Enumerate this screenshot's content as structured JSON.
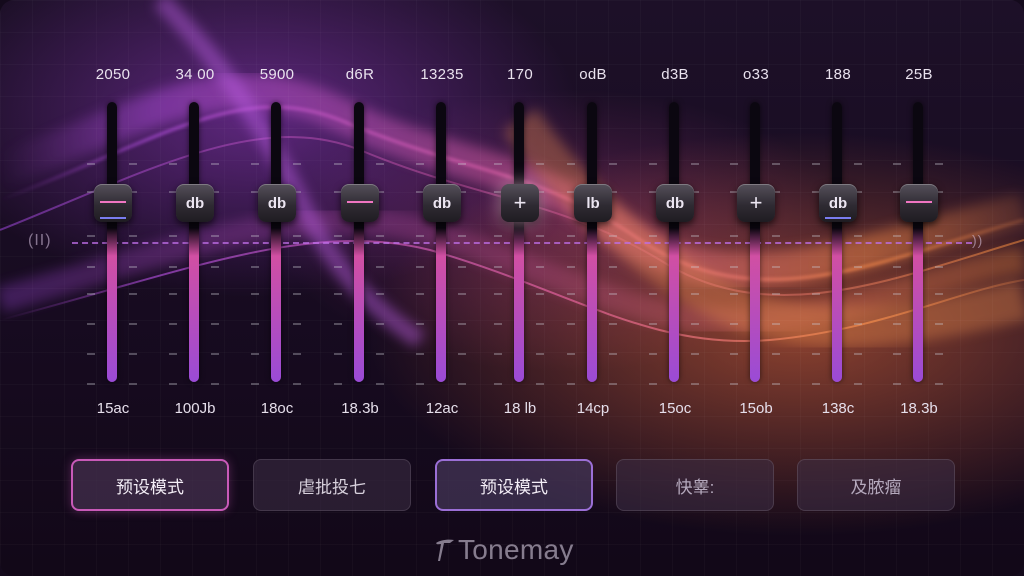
{
  "app": {
    "brand_name": "Tonemay",
    "accent_colors": {
      "pink": "#d14fa3",
      "violet": "#9a4bd6",
      "orange": "#f08a3c"
    }
  },
  "side_labels": {
    "left": "(II)",
    "right": "))"
  },
  "bands": [
    {
      "freq": "2050",
      "gain": "15ac",
      "knob_label": "",
      "knob_icon": "line-pink-blue"
    },
    {
      "freq": "34 00",
      "gain": "100Jb",
      "knob_label": "db",
      "knob_icon": ""
    },
    {
      "freq": "5900",
      "gain": "18oc",
      "knob_label": "db",
      "knob_icon": ""
    },
    {
      "freq": "d6R",
      "gain": "18.3b",
      "knob_label": "",
      "knob_icon": "line-pink"
    },
    {
      "freq": "13235",
      "gain": "12ac",
      "knob_label": "db",
      "knob_icon": ""
    },
    {
      "freq": "170",
      "gain": "18 lb",
      "knob_label": "",
      "knob_icon": "plus-glow"
    },
    {
      "freq": "odB",
      "gain": "14cp",
      "knob_label": "lb",
      "knob_icon": ""
    },
    {
      "freq": "d3B",
      "gain": "15oc",
      "knob_label": "db",
      "knob_icon": ""
    },
    {
      "freq": "o33",
      "gain": "15ob",
      "knob_label": "",
      "knob_icon": "plus"
    },
    {
      "freq": "188",
      "gain": "138c",
      "knob_label": "db",
      "knob_icon": "line-blue"
    },
    {
      "freq": "25B",
      "gain": "18.3b",
      "knob_label": "",
      "knob_icon": "line-pink"
    }
  ],
  "presets": [
    {
      "label": "预设模式",
      "state": "active-pink"
    },
    {
      "label": "虐批投七",
      "state": "normal"
    },
    {
      "label": "预设模式",
      "state": "active-violet"
    },
    {
      "label": "快睾:",
      "state": "dim"
    },
    {
      "label": "及脓瘤",
      "state": "dim"
    }
  ]
}
